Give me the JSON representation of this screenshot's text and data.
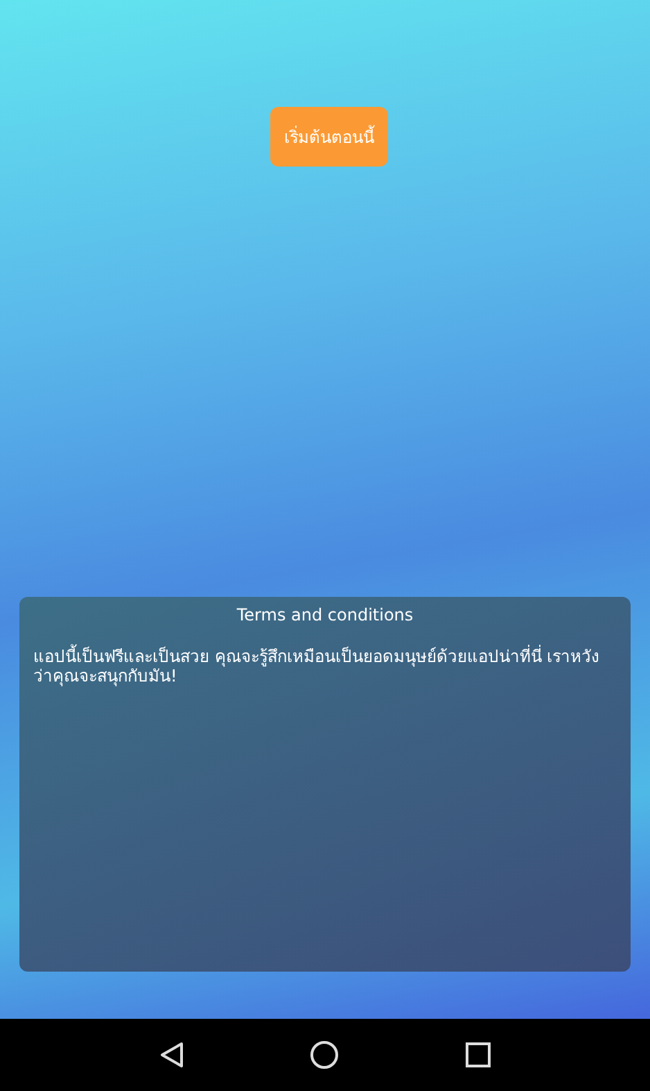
{
  "start_button": {
    "label": "เริ่มต้นตอนนี้"
  },
  "terms": {
    "title": "Terms and conditions",
    "body": "แอปนี้เป็นฟรีและเป็นสวย คุณจะรู้สึกเหมือนเป็นยอดมนุษย์ด้วยแอปน่าที่นี่ เราหวังว่าคุณจะสนุกกับมัน!"
  }
}
